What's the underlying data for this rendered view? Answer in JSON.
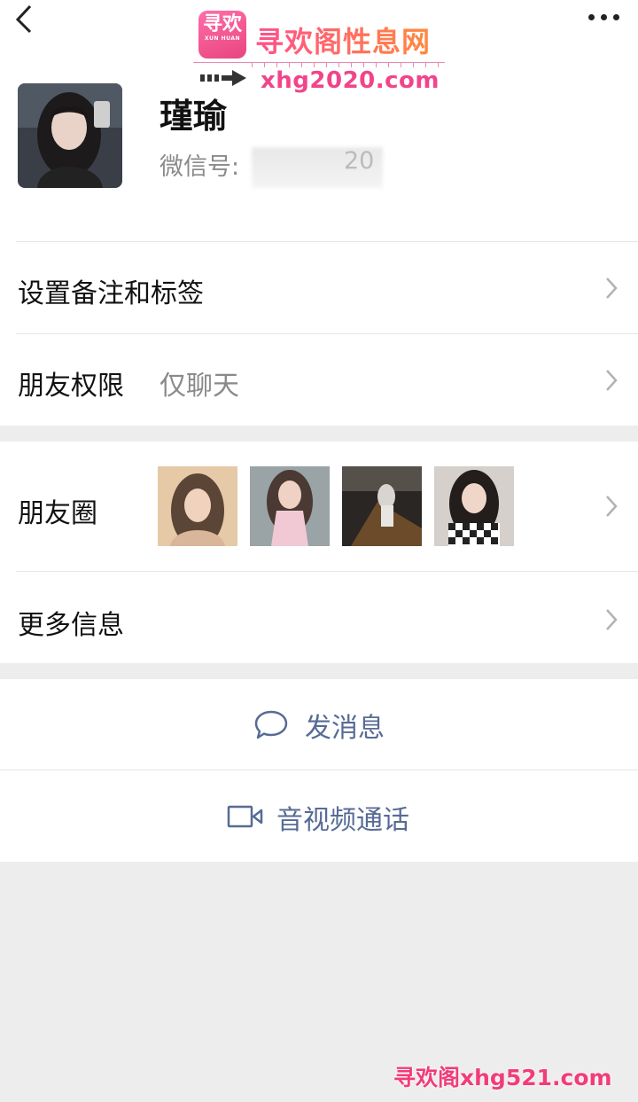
{
  "watermark_top": {
    "logo_text": "寻欢",
    "logo_small": "XUN HUAN",
    "title": "寻欢阁性息网",
    "url": "xhg2020.com"
  },
  "profile": {
    "name": "瑾瑜",
    "wechat_id_label": "微信号:",
    "wechat_id_visible": "20"
  },
  "rows": {
    "remark": "设置备注和标签",
    "permission_label": "朋友权限",
    "permission_value": "仅聊天",
    "moments": "朋友圈",
    "more_info": "更多信息"
  },
  "actions": {
    "message": "发消息",
    "call": "音视频通话"
  },
  "watermark_bottom": "寻欢阁xhg521.com",
  "colors": {
    "link": "#576b95",
    "background": "#ededed",
    "watermark": "#f2448a"
  }
}
